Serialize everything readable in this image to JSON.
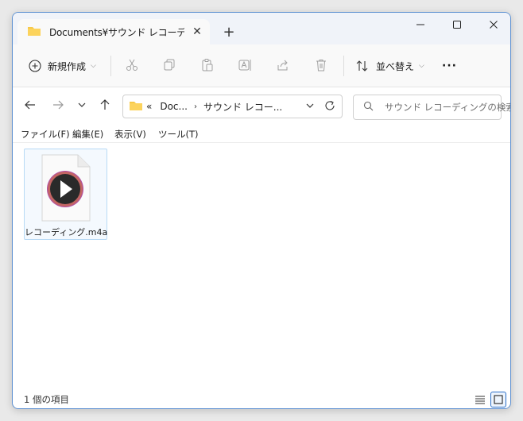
{
  "window": {
    "tab_title": "Documents¥サウンド レコーディング",
    "tab_close": "✕",
    "new_tab": "+"
  },
  "toolbar": {
    "new_label": "新規作成",
    "sort_label": "並べ替え",
    "more": "···"
  },
  "address": {
    "crumbs_prefix": "«",
    "crumb_1": "Doc...",
    "crumb_sep": "›",
    "crumb_2": "サウンド レコー..."
  },
  "search": {
    "placeholder": "サウンド レコーディングの検索"
  },
  "menu": {
    "file": "ファイル(F)",
    "edit": "編集(E)",
    "view": "表示(V)",
    "tools": "ツール(T)"
  },
  "files": [
    {
      "name": "レコーディング.m4a"
    }
  ],
  "status": {
    "count": "1 個の項目"
  },
  "colors": {
    "accent": "#2b6fc7",
    "folder": "#f7c948",
    "window_border": "#5b8fd1"
  }
}
